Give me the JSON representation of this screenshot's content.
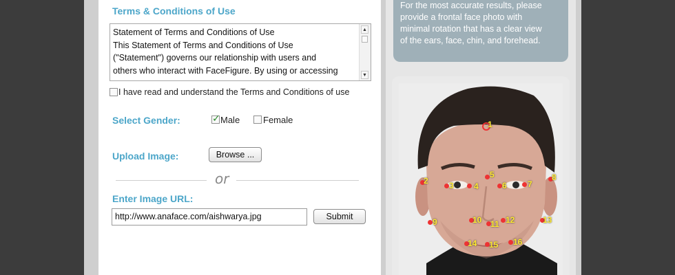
{
  "terms": {
    "heading": "Terms & Conditions of Use",
    "lines": [
      "Statement of Terms and Conditions of Use",
      "This Statement of Terms and Conditions of Use",
      "(\"Statement\") governs our relationship with users and",
      "others who interact with FaceFigure. By using or accessing"
    ],
    "agree_label": "I have read and understand the Terms and Conditions of use",
    "agree_checked": false
  },
  "gender": {
    "heading": "Select Gender:",
    "male_label": "Male",
    "male_checked": true,
    "female_label": "Female",
    "female_checked": false
  },
  "upload": {
    "heading": "Upload Image:",
    "browse_label": "Browse ..."
  },
  "divider": {
    "or_label": "or"
  },
  "url": {
    "heading": "Enter Image URL:",
    "value": "http://www.anaface.com/aishwarya.jpg",
    "submit_label": "Submit"
  },
  "info": {
    "lines": [
      "For the most accurate results, please",
      "provide a frontal face photo with",
      "minimal rotation that has a clear view",
      "of the ears, face, chin, and forehead."
    ]
  },
  "landmarks": [
    "1",
    "2",
    "3",
    "4",
    "5",
    "6",
    "7",
    "8",
    "9",
    "10",
    "11",
    "12",
    "13",
    "14",
    "15",
    "16"
  ],
  "colors": {
    "heading": "#4ca6c9",
    "info_bg": "#9fb0b8",
    "landmark_dot": "#e33333",
    "landmark_label": "#ffe830"
  }
}
